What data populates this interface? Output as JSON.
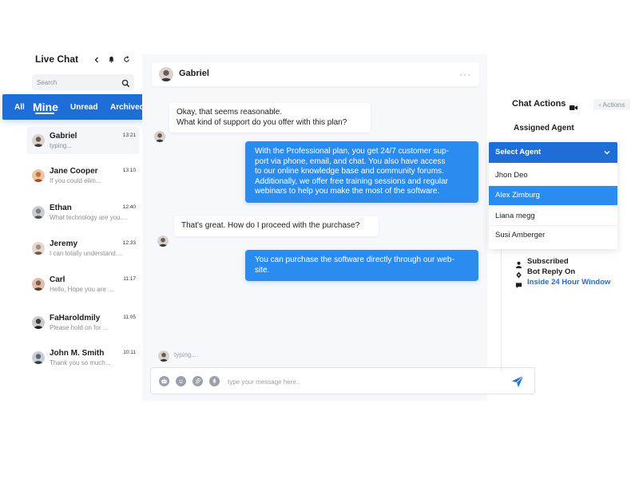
{
  "sidebar": {
    "title": "Live Chat",
    "search_placeholder": "Search",
    "tabs": [
      {
        "label": "All"
      },
      {
        "label": "Mine"
      },
      {
        "label": "Unread"
      },
      {
        "label": "Archived"
      }
    ],
    "chats": [
      {
        "name": "Gabriel",
        "time": "13:21",
        "preview": "typing...",
        "avatar_color": "#6b5b4f"
      },
      {
        "name": "Jane Cooper",
        "time": "13:10",
        "preview": "If you could elim...",
        "avatar_color": "#c8703a"
      },
      {
        "name": "Ethan",
        "time": "12:40",
        "preview": "What technology are you....",
        "avatar_color": "#7a7f86"
      },
      {
        "name": "Jeremy",
        "time": "12:33",
        "preview": "I can totally understand....",
        "avatar_color": "#a98c7d"
      },
      {
        "name": "Carl",
        "time": "11:17",
        "preview": "Hello, Hope you are ...",
        "avatar_color": "#8a5a44"
      },
      {
        "name": "FaHaroldmily",
        "time": "11:05",
        "preview": "Please hold on for ...",
        "avatar_color": "#3d3a3a"
      },
      {
        "name": "John M. Smith",
        "time": "10:11",
        "preview": "Thank you so much...",
        "avatar_color": "#5c6670"
      }
    ]
  },
  "chat": {
    "contact_name": "Gabriel",
    "more_label": "···",
    "messages": [
      {
        "direction": "in",
        "lines": [
          "Okay, that seems reasonable.",
          "What kind of support do you offer with this plan?"
        ]
      },
      {
        "direction": "out",
        "lines": [
          "With the Professional plan, you get 24/7 customer sup-",
          "port via phone, email, and chat. You also have access",
          "to our online knowledge base and community forums.",
          "Additionally, we offer free training sessions and regular",
          "webinars to help you make the most of the software."
        ]
      },
      {
        "direction": "in",
        "lines": [
          "That's great. How do I proceed with the purchase?"
        ]
      },
      {
        "direction": "out",
        "lines": [
          "You can purchase the software directly through our web-",
          "site."
        ]
      }
    ],
    "typing_text": "typing....",
    "composer_placeholder": "type your message here..",
    "accent_color": "#2b8cf0"
  },
  "right_panel": {
    "title": "Chat Actions",
    "actions_button": "‹ Actions",
    "assigned_label": "Assigned Agent",
    "select_label": "Select Agent",
    "agents": [
      {
        "name": "Jhon Deo",
        "selected": false
      },
      {
        "name": "Alex Zimburg",
        "selected": true
      },
      {
        "name": "Liana megg",
        "selected": false
      },
      {
        "name": "Susi Amberger",
        "selected": false
      }
    ],
    "status": [
      {
        "label": "Subscribed",
        "icon": "user-icon"
      },
      {
        "label": "Bot Reply On",
        "icon": "bot-icon"
      },
      {
        "label": "Inside 24 Hour Window",
        "icon": "chat-bubble-icon",
        "link": true
      }
    ],
    "brand_color": "#1f6ed8"
  }
}
